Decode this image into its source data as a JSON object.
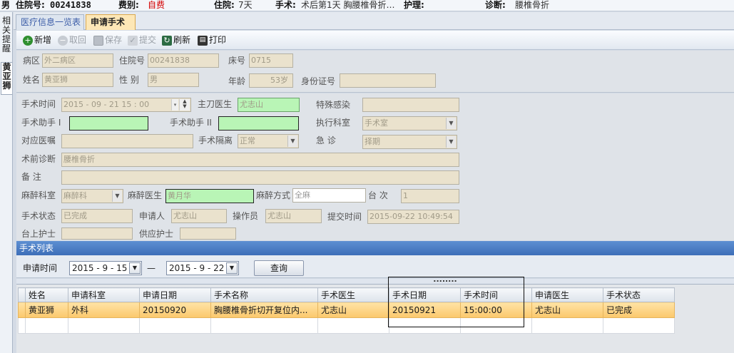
{
  "topbar": {
    "gender": "男",
    "admission_no_label": "住院号:",
    "admission_no": "00241838",
    "fee_label": "费别:",
    "fee_value": "自费",
    "stay_label": "住院:",
    "stay_value": "7天",
    "surgery_label": "手术:",
    "surgery_value": "术后第1天  胸腰椎骨折…",
    "nursing_label": "护理:",
    "nursing_value": "",
    "diagnosis_label": "诊断:",
    "diagnosis_value": "腰椎骨折"
  },
  "sidebar": {
    "tab1": "相关提醒",
    "tab2": "黄亚狮"
  },
  "tabs": [
    {
      "label": "医疗信息一览表"
    },
    {
      "label": "申请手术"
    }
  ],
  "toolbar": {
    "new": "新增",
    "withdraw": "取回",
    "save": "保存",
    "submit": "提交",
    "refresh": "刷新",
    "print": "打印"
  },
  "patient": {
    "ward_label": "病区",
    "ward": "外二病区",
    "admission_label": "住院号",
    "admission": "00241838",
    "bed_label": "床号",
    "bed": "0715",
    "name_label": "姓名",
    "name": "黄亚狮",
    "sex_label": "性  别",
    "sex": "男",
    "age_label": "年龄",
    "age": "53岁",
    "id_label": "身份证号",
    "id": ""
  },
  "form": {
    "time_label": "手术时间",
    "time": "2015 - 09 - 21   15 : 00",
    "surgeon_label": "主刀医生",
    "surgeon": "尤志山",
    "infection_label": "特殊感染",
    "infection": "",
    "assistant1_label": "手术助手 I",
    "assistant1": "",
    "assistant2_label": "手术助手 II",
    "assistant2": "",
    "dept_label": "执行科室",
    "dept": "手术室",
    "orders_label": "对应医嘱",
    "orders": "",
    "isolation_label": "手术隔离",
    "isolation": "正常",
    "urgent_label": "急    诊",
    "urgent": "择期",
    "prediag_label": "术前诊断",
    "prediag": "腰椎骨折",
    "note_label": "备    注",
    "note": "",
    "anes_dept_label": "麻醉科室",
    "anes_dept": "麻醉科",
    "anes_doc_label": "麻醉医生",
    "anes_doc": "黄月华",
    "anes_method_label": "麻醉方式",
    "anes_method": "全麻",
    "table_label": "台  次",
    "table_no": "1",
    "status_label": "手术状态",
    "status": "已完成",
    "applicant_label": "申请人",
    "applicant": "尤志山",
    "operator_label": "操作员",
    "operator": "尤志山",
    "submit_time_label": "提交时间",
    "submit_time": "2015-09-22 10:49:54",
    "nurse_on_label": "台上护士",
    "nurse_on": "",
    "nurse_supply_label": "供应护士",
    "nurse_supply": ""
  },
  "list": {
    "title": "手术列表",
    "apply_time_label": "申请时间",
    "date_from": "2015 - 9 - 15",
    "dash": "—",
    "date_to": "2015 - 9 - 22",
    "query": "查询",
    "splitter": "........",
    "columns": [
      "姓名",
      "申请科室",
      "申请日期",
      "手术名称",
      "手术医生",
      "手术日期",
      "手术时间",
      "申请医生",
      "手术状态"
    ],
    "rows": [
      [
        "黄亚狮",
        "外科",
        "20150920",
        "胸腰椎骨折切开复位内...",
        "尤志山",
        "20150921",
        "15:00:00",
        "尤志山",
        "已完成"
      ]
    ]
  },
  "colors": {
    "accent": "#3d6eb8",
    "selected_row": "#fbc86c",
    "readonly_field": "#eae2cd",
    "editable_green": "#b9f5b6",
    "fee_red": "#d40000"
  }
}
